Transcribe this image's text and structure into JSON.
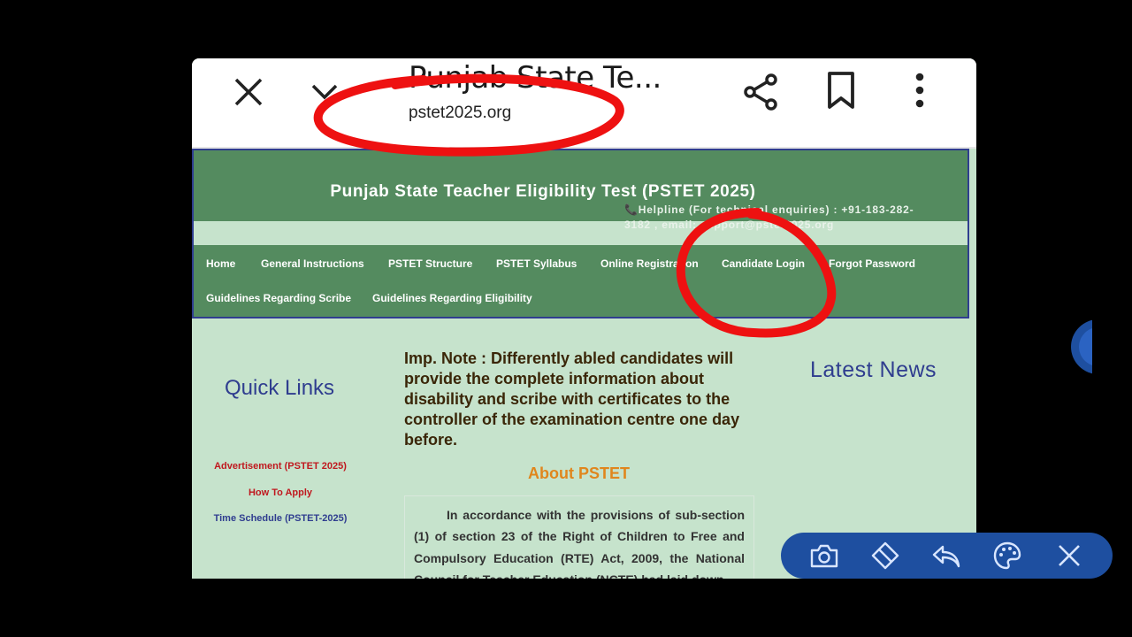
{
  "browser": {
    "title": "Punjab State Te...",
    "url": "pstet2025.org"
  },
  "header": {
    "title": "Punjab State Teacher Eligibility Test (PSTET 2025)",
    "helpline": "📞Helpline (For technical enquiries) : +91-183-282-3182 , email: support@pstet2025.org"
  },
  "nav": {
    "home": "Home",
    "general_instructions": "General Instructions",
    "structure": "PSTET Structure",
    "syllabus": "PSTET Syllabus",
    "online_registration": "Online Registration",
    "candidate_login": "Candidate Login",
    "forgot_password": "Forgot Password",
    "guidelines_scribe": "Guidelines Regarding Scribe",
    "guidelines_eligibility": "Guidelines Regarding Eligibility"
  },
  "quick_links": {
    "title": "Quick Links",
    "items": [
      {
        "label": "Advertisement (PSTET 2025)",
        "color": "#c0181e"
      },
      {
        "label": "How To Apply",
        "color": "#c0181e"
      },
      {
        "label": "Time Schedule (PSTET-2025)",
        "color": "#2f3d8f"
      }
    ]
  },
  "main": {
    "note": "Imp. Note : Differently abled candidates will provide the complete information about disability and scribe with certificates to the controller of the examination centre one day before.",
    "about_title": "About PSTET",
    "about_text": "In accordance with the provisions of sub-section (1) of section 23 of the Right of Children to Free and Compulsory Education (RTE) Act, 2009, the National Council for Teacher Education (NCTE) had laid down"
  },
  "latest_news": {
    "title": "Latest News"
  },
  "colors": {
    "header_green": "#548b5f",
    "page_bg": "#c6e3cc",
    "link_blue": "#2f3d8f",
    "accent_orange": "#e0861d",
    "annotation_red": "#ee1111",
    "toolbar_blue": "#1e4fa0"
  },
  "icons": {
    "browser": [
      "close-icon",
      "chevron-down-icon",
      "share-icon",
      "bookmark-icon",
      "more-vert-icon"
    ],
    "toolbar": [
      "camera-icon",
      "eraser-icon",
      "undo-icon",
      "palette-icon",
      "close-icon"
    ]
  }
}
